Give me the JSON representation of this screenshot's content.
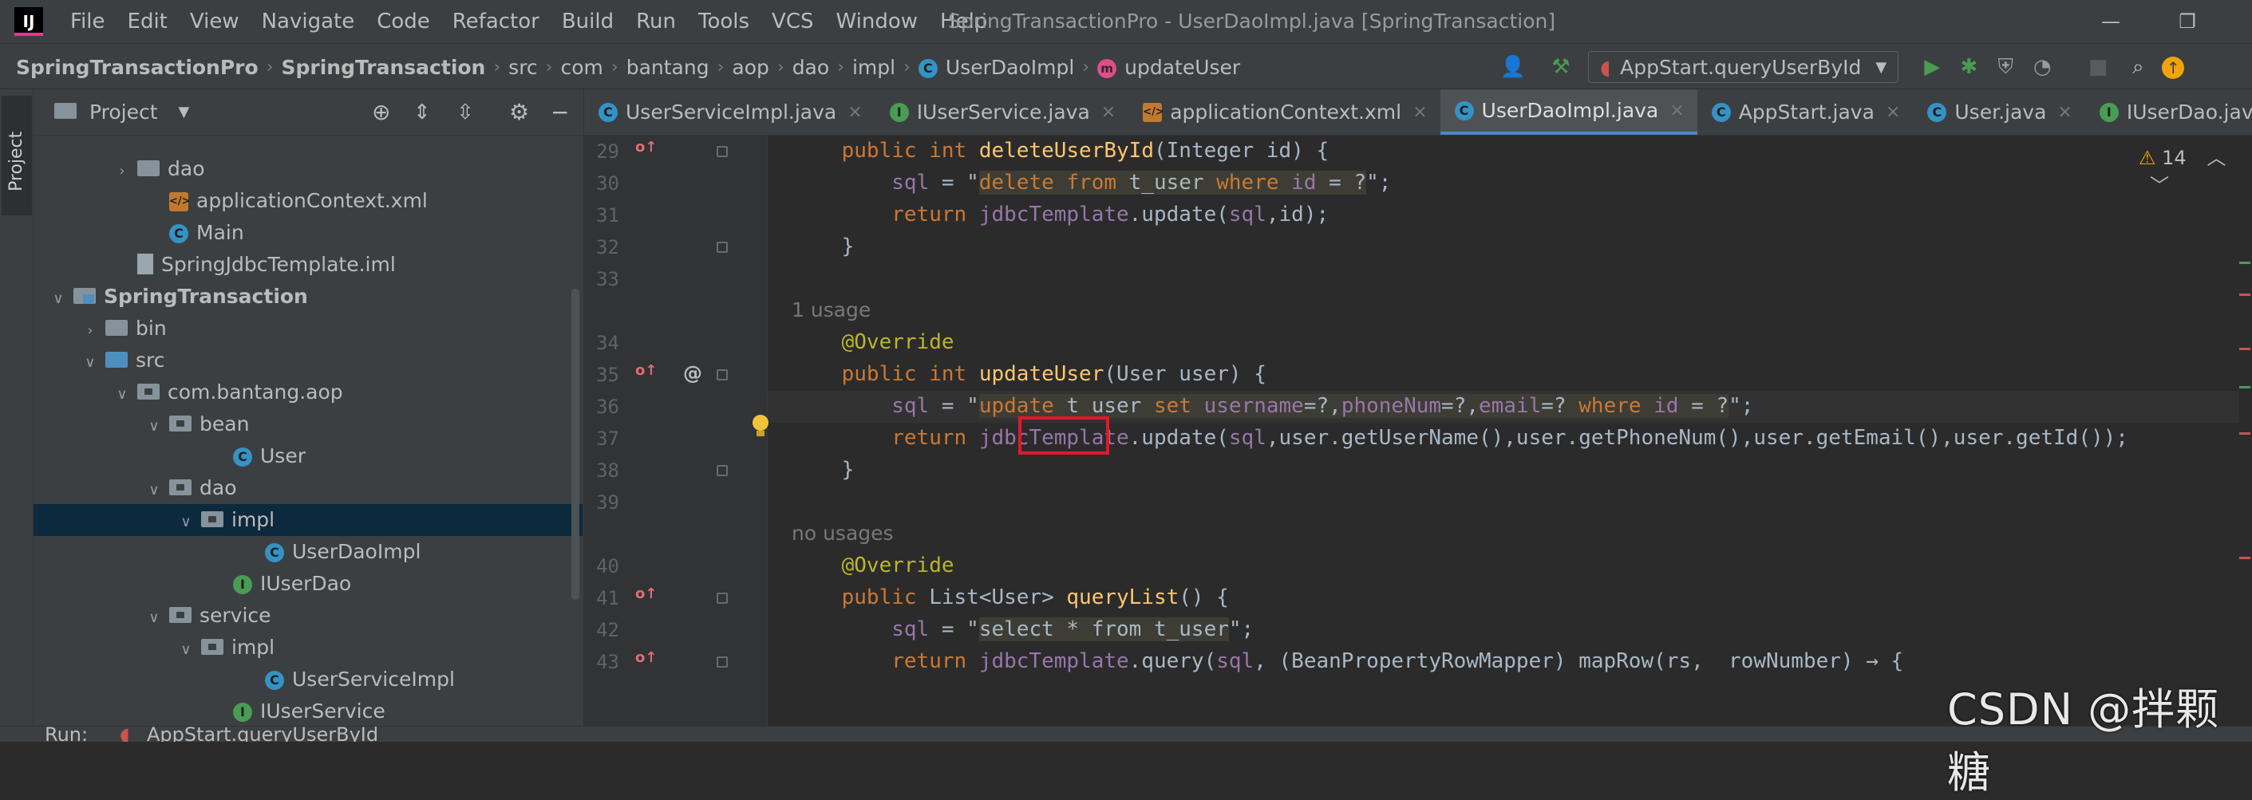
{
  "window": {
    "title": "SpringTransactionPro - UserDaoImpl.java [SpringTransaction]",
    "logo_text": "IJ",
    "menus": [
      "File",
      "Edit",
      "View",
      "Navigate",
      "Code",
      "Refactor",
      "Build",
      "Run",
      "Tools",
      "VCS",
      "Window",
      "Help"
    ],
    "minimize": "—",
    "restore": "❐"
  },
  "breadcrumb": [
    "SpringTransactionPro",
    "SpringTransaction",
    "src",
    "com",
    "bantang",
    "aop",
    "dao",
    "impl",
    "UserDaoImpl",
    "updateUser"
  ],
  "toolbar": {
    "run_config": "AppStart.queryUserById",
    "icons": [
      "user-icon",
      "hammer-icon",
      "run-icon",
      "debug-icon",
      "coverage-icon",
      "profile-icon",
      "stop-icon",
      "search-icon",
      "update-icon"
    ]
  },
  "toolstrip": {
    "project_tab": "Project"
  },
  "project_panel": {
    "title": "Project",
    "tree": [
      {
        "label": "dao",
        "indent": 3,
        "kind": "folder",
        "arrow": "›"
      },
      {
        "label": "applicationContext.xml",
        "indent": 4,
        "kind": "xml",
        "arrow": ""
      },
      {
        "label": "Main",
        "indent": 4,
        "kind": "class",
        "arrow": ""
      },
      {
        "label": "SpringJdbcTemplate.iml",
        "indent": 3,
        "kind": "file",
        "arrow": ""
      },
      {
        "label": "SpringTransaction",
        "indent": 1,
        "kind": "module",
        "arrow": "⌄",
        "bold": true
      },
      {
        "label": "bin",
        "indent": 2,
        "kind": "folder",
        "arrow": "›"
      },
      {
        "label": "src",
        "indent": 2,
        "kind": "srcfolder",
        "arrow": "⌄"
      },
      {
        "label": "com.bantang.aop",
        "indent": 3,
        "kind": "pkg",
        "arrow": "⌄"
      },
      {
        "label": "bean",
        "indent": 4,
        "kind": "pkg",
        "arrow": "⌄"
      },
      {
        "label": "User",
        "indent": 6,
        "kind": "class",
        "arrow": ""
      },
      {
        "label": "dao",
        "indent": 4,
        "kind": "pkg",
        "arrow": "⌄"
      },
      {
        "label": "impl",
        "indent": 5,
        "kind": "pkg",
        "arrow": "⌄",
        "selected": true
      },
      {
        "label": "UserDaoImpl",
        "indent": 7,
        "kind": "class",
        "arrow": ""
      },
      {
        "label": "IUserDao",
        "indent": 6,
        "kind": "interface",
        "arrow": ""
      },
      {
        "label": "service",
        "indent": 4,
        "kind": "pkg",
        "arrow": "⌄"
      },
      {
        "label": "impl",
        "indent": 5,
        "kind": "pkg",
        "arrow": "⌄"
      },
      {
        "label": "UserServiceImpl",
        "indent": 7,
        "kind": "class",
        "arrow": ""
      },
      {
        "label": "IUserService",
        "indent": 6,
        "kind": "interface",
        "arrow": ""
      }
    ]
  },
  "tabs": [
    {
      "label": "UserServiceImpl.java",
      "kind": "class",
      "active": false
    },
    {
      "label": "IUserService.java",
      "kind": "interface",
      "active": false
    },
    {
      "label": "applicationContext.xml",
      "kind": "xml",
      "active": false
    },
    {
      "label": "UserDaoImpl.java",
      "kind": "class",
      "active": true
    },
    {
      "label": "AppStart.java",
      "kind": "class",
      "active": false
    },
    {
      "label": "User.java",
      "kind": "class",
      "active": false
    },
    {
      "label": "IUserDao.java",
      "kind": "interface",
      "active": false
    }
  ],
  "editor": {
    "warnings_count": "14",
    "lines": [
      {
        "num": "29",
        "override": true,
        "fold": true,
        "tokens": [
          [
            "    ",
            ""
          ],
          [
            "public ",
            "kw"
          ],
          [
            "int ",
            "kw"
          ],
          [
            "deleteUserById",
            "fn"
          ],
          [
            "(Integer id) {",
            ""
          ]
        ]
      },
      {
        "num": "30",
        "tokens": [
          [
            "        ",
            ""
          ],
          [
            "sql",
            "var"
          ],
          [
            " = \"",
            ""
          ],
          [
            "delete from ",
            "sqlkw sqlbg"
          ],
          [
            "t_user ",
            "sqlid sqlbg"
          ],
          [
            "where ",
            "sqlkw sqlbg"
          ],
          [
            "id ",
            "sqlcol sqlbg"
          ],
          [
            "= ?",
            "sqlid sqlbg"
          ],
          [
            "\";",
            ""
          ]
        ]
      },
      {
        "num": "31",
        "tokens": [
          [
            "        ",
            ""
          ],
          [
            "return ",
            "kw"
          ],
          [
            "jdbcTemplate",
            "var"
          ],
          [
            ".update(",
            ""
          ],
          [
            "sql",
            "var"
          ],
          [
            ",id);",
            ""
          ]
        ]
      },
      {
        "num": "32",
        "fold": true,
        "tokens": [
          [
            "    }",
            ""
          ]
        ]
      },
      {
        "num": "33",
        "tokens": []
      },
      {
        "hint": "1 usage"
      },
      {
        "num": "34",
        "tokens": [
          [
            "    ",
            ""
          ],
          [
            "@Override",
            "ann"
          ]
        ]
      },
      {
        "num": "35",
        "override": true,
        "at": true,
        "fold": true,
        "tokens": [
          [
            "    ",
            ""
          ],
          [
            "public ",
            "kw"
          ],
          [
            "int ",
            "kw"
          ],
          [
            "updateUser",
            "fn"
          ],
          [
            "(User user) {",
            ""
          ]
        ]
      },
      {
        "num": "36",
        "current": true,
        "tokens": [
          [
            "        ",
            ""
          ],
          [
            "sql",
            "var"
          ],
          [
            " = \"",
            ""
          ],
          [
            "update ",
            "sqlkw sqlbg"
          ],
          [
            "t_user ",
            "sqlid sqlbg"
          ],
          [
            "set ",
            "sqlkw sqlbg"
          ],
          [
            "username",
            "sqlcol sqlbg"
          ],
          [
            "=?,",
            "sqlid sqlbg"
          ],
          [
            "phoneNum",
            "sqlcol sqlbg"
          ],
          [
            "=?,",
            "sqlid sqlbg"
          ],
          [
            "email",
            "sqlcol sqlbg"
          ],
          [
            "=? ",
            "sqlid sqlbg"
          ],
          [
            "where ",
            "sqlkw sqlbg"
          ],
          [
            "id ",
            "sqlcol sqlbg"
          ],
          [
            "= ?",
            "sqlid sqlbg"
          ],
          [
            "\";",
            ""
          ]
        ]
      },
      {
        "num": "37",
        "tokens": [
          [
            "        ",
            ""
          ],
          [
            "return ",
            "kw"
          ],
          [
            "jdbcTemplate",
            "var"
          ],
          [
            ".update(",
            ""
          ],
          [
            "sql",
            "var"
          ],
          [
            ",user.getUserName(),user.getPhoneNum(),user.getEmail(),user.getId());",
            ""
          ]
        ]
      },
      {
        "num": "38",
        "fold": true,
        "tokens": [
          [
            "    }",
            ""
          ]
        ]
      },
      {
        "num": "39",
        "tokens": []
      },
      {
        "hint": "no usages"
      },
      {
        "num": "40",
        "tokens": [
          [
            "    ",
            ""
          ],
          [
            "@Override",
            "ann"
          ]
        ]
      },
      {
        "num": "41",
        "override": true,
        "fold": true,
        "tokens": [
          [
            "    ",
            ""
          ],
          [
            "public ",
            "kw"
          ],
          [
            "List<User> ",
            ""
          ],
          [
            "queryList",
            "fn"
          ],
          [
            "() {",
            ""
          ]
        ]
      },
      {
        "num": "42",
        "tokens": [
          [
            "        ",
            ""
          ],
          [
            "sql",
            "var"
          ],
          [
            " = \"",
            ""
          ],
          [
            "select * from t_user",
            "sqlid sqlbg"
          ],
          [
            "\";",
            ""
          ]
        ]
      },
      {
        "num": "43",
        "override": true,
        "fold": true,
        "tokens": [
          [
            "        ",
            ""
          ],
          [
            "return ",
            "kw"
          ],
          [
            "jdbcTemplate",
            "var"
          ],
          [
            ".query(",
            ""
          ],
          [
            "sql",
            "var"
          ],
          [
            ", (BeanPropertyRowMapper) mapRow(rs,  rowNumber) → {",
            ""
          ]
        ]
      }
    ]
  },
  "bottom": {
    "run_label": "Run:",
    "run_config": "AppStart.queryUserById"
  },
  "watermark": "CSDN @拌颗糖",
  "colors": {
    "accent": "#4a88c7",
    "highlight_box": "#e0192c",
    "selection": "#0d293e"
  }
}
